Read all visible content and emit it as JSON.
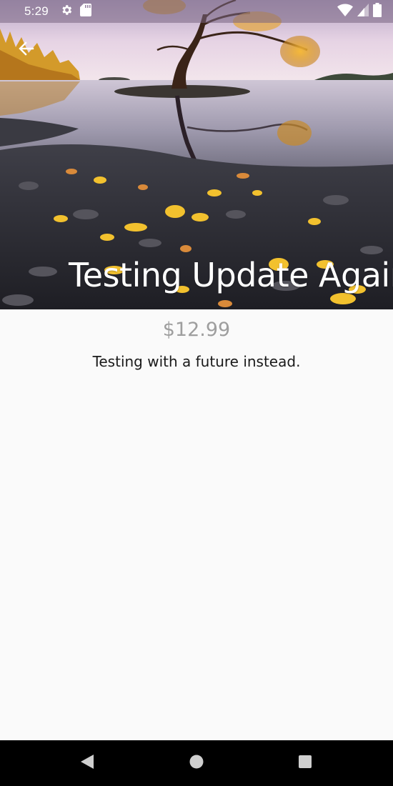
{
  "status_bar": {
    "time": "5:29",
    "icons": {
      "left": [
        "gear-icon",
        "sd-card-icon"
      ],
      "right": [
        "wifi-icon",
        "cell-signal-icon",
        "battery-icon"
      ]
    }
  },
  "header": {
    "back_icon": "arrow-left-icon",
    "title": "Testing Update Again!"
  },
  "product": {
    "price": "$12.99",
    "description": "Testing with a future instead."
  },
  "nav_bar": {
    "icons": [
      "back-triangle-icon",
      "home-circle-icon",
      "recents-square-icon"
    ]
  },
  "colors": {
    "background": "#fafafa",
    "price_text": "#9e9e9e",
    "body_text": "#1a1a1a",
    "title_text": "#ffffff",
    "nav_bar": "#000000"
  }
}
